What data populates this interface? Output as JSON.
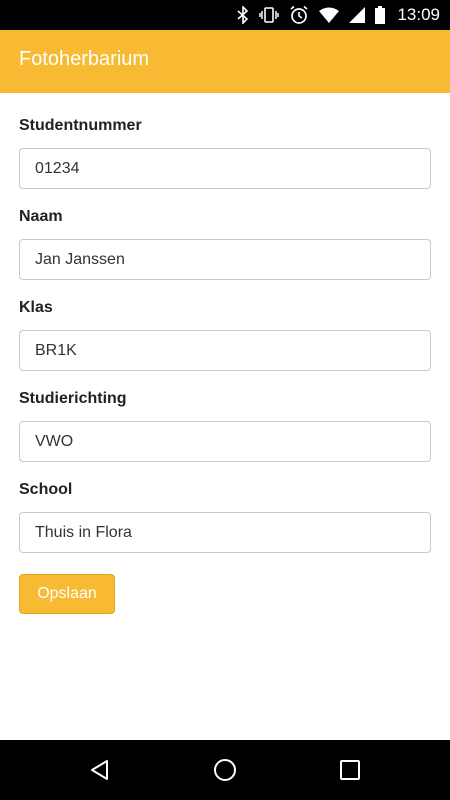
{
  "status_bar": {
    "time": "13:09",
    "icons": [
      "bluetooth-icon",
      "vibrate-icon",
      "alarm-icon",
      "wifi-icon",
      "signal-icon",
      "battery-icon"
    ]
  },
  "app_bar": {
    "title": "Fotoherbarium",
    "color": "#F8BA32"
  },
  "form": {
    "fields": [
      {
        "label": "Studentnummer",
        "value": "01234"
      },
      {
        "label": "Naam",
        "value": "Jan Janssen"
      },
      {
        "label": "Klas",
        "value": "BR1K"
      },
      {
        "label": "Studierichting",
        "value": "VWO"
      },
      {
        "label": "School",
        "value": "Thuis in Flora"
      }
    ],
    "save_label": "Opslaan"
  },
  "nav_bar": {
    "icons": [
      "back-icon",
      "home-icon",
      "recents-icon"
    ]
  }
}
